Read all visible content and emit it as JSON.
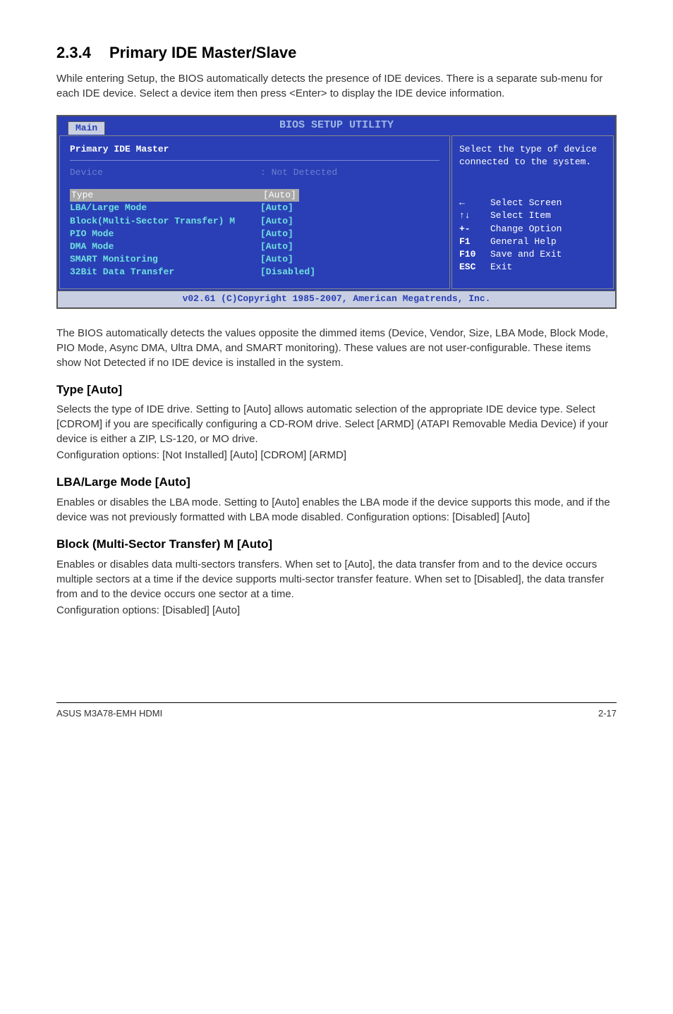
{
  "section": {
    "number": "2.3.4",
    "title": "Primary IDE Master/Slave",
    "intro": "While entering Setup, the BIOS automatically detects the presence of IDE devices. There is a separate sub-menu for each IDE device. Select a device item then press <Enter> to display the IDE device information."
  },
  "bios": {
    "title": "BIOS SETUP UTILITY",
    "tab": "Main",
    "panel_title": "Primary IDE Master",
    "device_label": "Device",
    "device_value": ": Not Detected",
    "rows": [
      {
        "label": "Type",
        "value": "[Auto]",
        "selected": true
      },
      {
        "label": "LBA/Large Mode",
        "value": "[Auto]"
      },
      {
        "label": "Block(Multi-Sector Transfer) M",
        "value": "[Auto]"
      },
      {
        "label": "PIO Mode",
        "value": "[Auto]"
      },
      {
        "label": "DMA Mode",
        "value": "[Auto]"
      },
      {
        "label": "SMART Monitoring",
        "value": "[Auto]"
      },
      {
        "label": "32Bit Data Transfer",
        "value": "[Disabled]"
      }
    ],
    "help_text": "Select the type of device connected to the system.",
    "keys": [
      {
        "key": "←",
        "action": "Select Screen"
      },
      {
        "key": "↑↓",
        "action": "Select Item"
      },
      {
        "key": "+-",
        "action": "Change Option"
      },
      {
        "key": "F1",
        "action": "General Help"
      },
      {
        "key": "F10",
        "action": "Save and Exit"
      },
      {
        "key": "ESC",
        "action": "Exit"
      }
    ],
    "footer": "v02.61 (C)Copyright 1985-2007, American Megatrends, Inc."
  },
  "after_bios_para": "The BIOS automatically detects the values opposite the dimmed items (Device, Vendor, Size, LBA Mode, Block Mode, PIO Mode, Async DMA, Ultra DMA, and SMART monitoring). These values are not user-configurable. These items show Not Detected if no IDE device is installed in the system.",
  "type_section": {
    "heading": "Type [Auto]",
    "para1": "Selects the type of IDE drive. Setting to [Auto] allows automatic selection of the appropriate IDE device type. Select [CDROM] if you are specifically configuring a CD-ROM drive. Select [ARMD] (ATAPI Removable Media Device) if your device is either a ZIP, LS-120, or MO drive.",
    "para2": "Configuration options: [Not Installed] [Auto] [CDROM] [ARMD]"
  },
  "lba_section": {
    "heading": "LBA/Large Mode [Auto]",
    "para": "Enables or disables the LBA mode. Setting to [Auto] enables the LBA mode if the device supports this mode, and if the device was not previously formatted with LBA mode disabled. Configuration options: [Disabled] [Auto]"
  },
  "block_section": {
    "heading": "Block (Multi-Sector Transfer) M [Auto]",
    "para1": "Enables or disables data multi-sectors transfers. When set to [Auto], the data transfer from and to the device occurs multiple sectors at a time if the device supports multi-sector transfer feature. When set to [Disabled], the data transfer from and to the device occurs one sector at a time.",
    "para2": "Configuration options: [Disabled] [Auto]"
  },
  "footer": {
    "left": "ASUS M3A78-EMH HDMI",
    "right": "2-17"
  }
}
